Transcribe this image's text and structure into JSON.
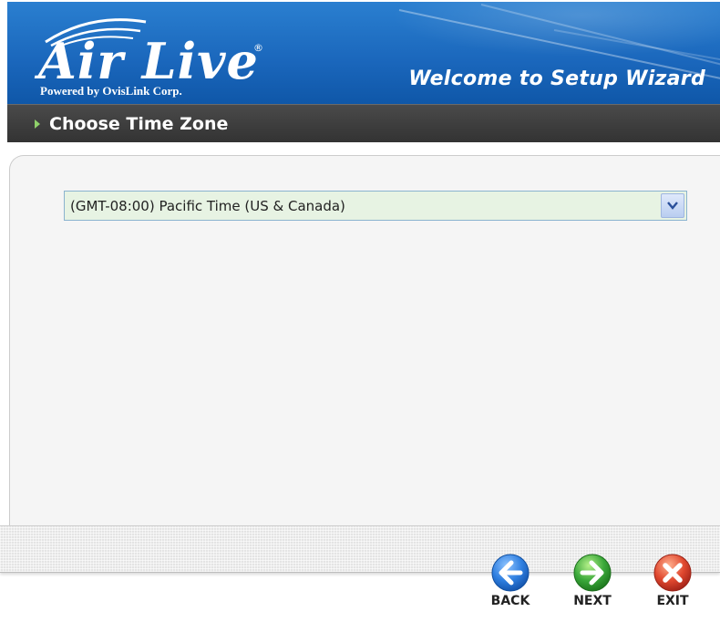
{
  "header": {
    "logo_text": "Air Live",
    "logo_subtext": "Powered by OvisLink Corp.",
    "logo_registered": "®",
    "wizard_title": "Welcome to Setup Wizard",
    "banner_color": "#1a66bb"
  },
  "section": {
    "title": "Choose Time Zone",
    "arrow_color": "#8fd16a"
  },
  "timezone_select": {
    "selected_value": "(GMT-08:00) Pacific Time (US & Canada)"
  },
  "nav": {
    "back": {
      "label": "BACK",
      "icon": "arrow-left-icon",
      "color": "#2f7fe0"
    },
    "next": {
      "label": "NEXT",
      "icon": "arrow-right-icon",
      "color": "#3aa83a"
    },
    "exit": {
      "label": "EXIT",
      "icon": "close-icon",
      "color": "#e0482f"
    }
  }
}
